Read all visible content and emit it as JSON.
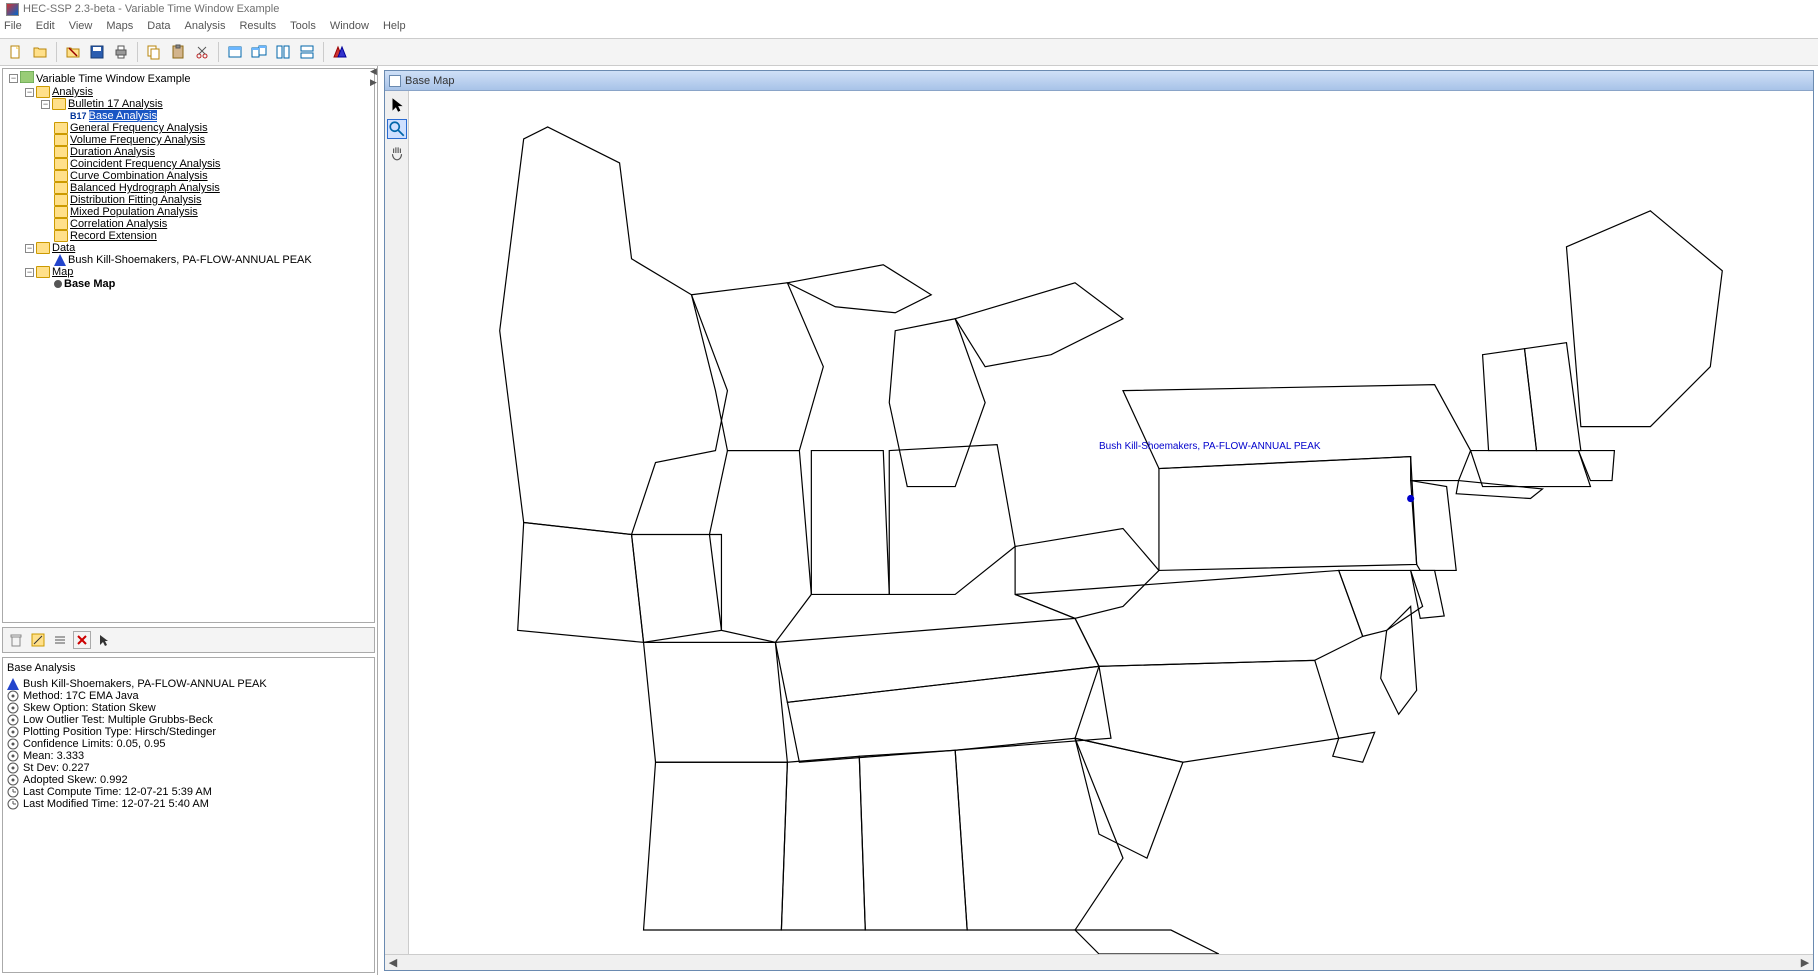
{
  "title": "HEC-SSP 2.3-beta - Variable Time Window Example",
  "menu": [
    "File",
    "Edit",
    "View",
    "Maps",
    "Data",
    "Analysis",
    "Results",
    "Tools",
    "Window",
    "Help"
  ],
  "tree": {
    "root": "Variable Time Window Example",
    "analysis_label": "Analysis",
    "bulletin17": "Bulletin 17 Analysis",
    "base_analysis": "Base Analysis",
    "items": [
      "General Frequency Analysis",
      "Volume Frequency Analysis",
      "Duration Analysis",
      "Coincident Frequency Analysis",
      "Curve Combination Analysis",
      "Balanced Hydrograph Analysis",
      "Distribution Fitting Analysis",
      "Mixed Population Analysis",
      "Correlation Analysis",
      "Record Extension"
    ],
    "data_label": "Data",
    "data_item": "Bush Kill-Shoemakers, PA-FLOW-ANNUAL PEAK",
    "map_label": "Map",
    "map_item": "Base Map"
  },
  "details": {
    "title": "Base Analysis",
    "station": "Bush Kill-Shoemakers, PA-FLOW-ANNUAL PEAK",
    "lines": [
      "Method: 17C EMA Java",
      "Skew Option: Station Skew",
      "Low Outlier Test: Multiple Grubbs-Beck",
      "Plotting Position Type: Hirsch/Stedinger",
      "Confidence Limits: 0.05, 0.95",
      "Mean: 3.333",
      "St Dev: 0.227",
      "Adopted Skew: 0.992"
    ],
    "compute_time": "Last Compute Time: 12-07-21 5:39 AM",
    "modified_time": "Last Modified Time: 12-07-21 5:40 AM"
  },
  "map_window": {
    "title": "Base Map",
    "point_label": "Bush Kill-Shoemakers, PA-FLOW-ANNUAL PEAK"
  }
}
